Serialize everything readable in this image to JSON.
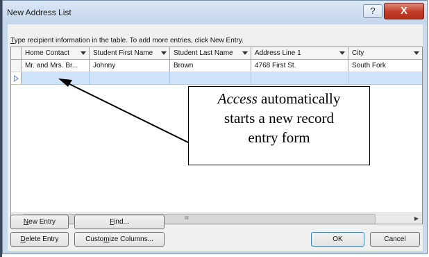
{
  "window": {
    "title": "New Address List",
    "help_label": "?",
    "close_label": "X"
  },
  "instruction": {
    "first_letter": "T",
    "rest": "ype recipient information in the table.  To add more entries, click New Entry."
  },
  "table": {
    "columns": [
      "Home Contact",
      "Student First Name",
      "Student Last Name",
      "Address Line 1",
      "City"
    ],
    "rows": [
      [
        "Mr. and Mrs. Br...",
        "Johnny",
        "Brown",
        "4768 First St.",
        "South Fork"
      ],
      [
        "",
        "",
        "",
        "",
        ""
      ]
    ]
  },
  "scrollbar": {
    "grip": "III"
  },
  "callout": {
    "italic_word": "Access",
    "line1_rest": " automatically",
    "line2": "starts a new record",
    "line3": "entry form"
  },
  "buttons": {
    "new_entry": {
      "mnemonic": "N",
      "rest": "ew Entry"
    },
    "find": {
      "mnemonic": "F",
      "rest": "ind..."
    },
    "delete_entry": {
      "mnemonic": "D",
      "rest": "elete Entry"
    },
    "customize_pre": "Custo",
    "customize_mnemonic": "m",
    "customize_post": "ize Columns...",
    "ok": "OK",
    "cancel": "Cancel"
  }
}
